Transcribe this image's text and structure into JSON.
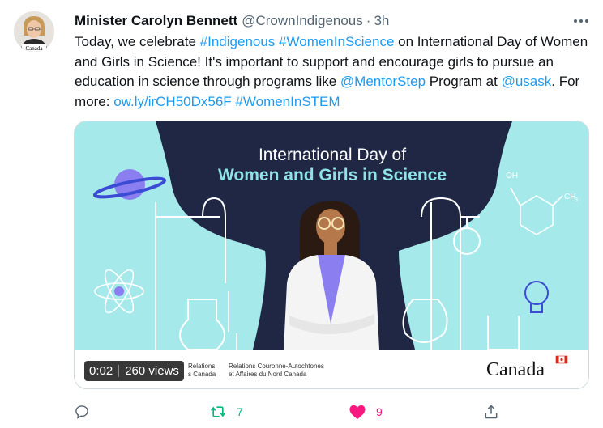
{
  "tweet": {
    "avatar_caption": "Canada",
    "display_name": "Minister Carolyn Bennett",
    "handle": "@CrownIndigenous",
    "separator": "·",
    "time": "3h",
    "more_icon": "more-dots-icon",
    "text_segments": [
      {
        "text": "Today, we celebrate ",
        "link": false
      },
      {
        "text": "#Indigenous",
        "link": true
      },
      {
        "text": " ",
        "link": false
      },
      {
        "text": "#WomenInScience",
        "link": true
      },
      {
        "text": " on International Day of Women and Girls in Science! It's important to support and encourage girls to pursue an education in science through programs like ",
        "link": false
      },
      {
        "text": "@MentorStep",
        "link": true
      },
      {
        "text": " Program at ",
        "link": false
      },
      {
        "text": "@usask",
        "link": true
      },
      {
        "text": ". For more: ",
        "link": false
      },
      {
        "text": "ow.ly/irCH50Dx56F",
        "link": true
      },
      {
        "text": " ",
        "link": false
      },
      {
        "text": "#WomenInSTEM",
        "link": true
      }
    ]
  },
  "media": {
    "title_line1": "International Day of",
    "title_line2": "Women and Girls in Science",
    "chem_oh": "OH",
    "chem_ch3": "CH",
    "chem_sub": "3",
    "footer_en_1": "Relations",
    "footer_en_2": "s Canada",
    "footer_fr_1": "Relations Couronne-Autochtones",
    "footer_fr_2": "et Affaires du Nord Canada",
    "wordmark": "Canada",
    "video_time": "0:02",
    "video_views": "260 views"
  },
  "actions": {
    "reply_icon": "reply-icon",
    "retweet_icon": "retweet-icon",
    "retweet_count": "7",
    "like_icon": "heart-icon",
    "like_count": "9",
    "share_icon": "share-icon"
  },
  "colors": {
    "link": "#1d9bf0",
    "retweet": "#00ba7c",
    "like": "#f91880",
    "muted": "#536471",
    "media_navy": "#1f2745",
    "media_aqua": "#a6e9ea"
  }
}
